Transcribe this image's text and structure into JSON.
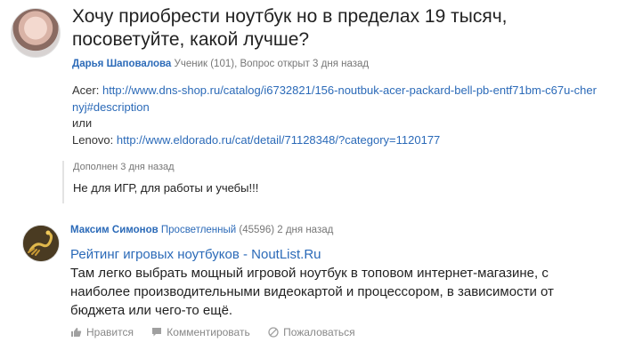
{
  "question": {
    "title": "Хочу приобрести ноутбук но в пределах 19 тысяч, посоветуйте, какой лучше?",
    "author": "Дарья Шаповалова",
    "author_meta": "Ученик (101), Вопрос открыт 3 дня назад",
    "body": {
      "acer_label": "Acer: ",
      "acer_link": "http://www.dns-shop.ru/catalog/i6732821/156-noutbuk-acer-packard-bell-pb-entf71bm-c67u-chernyj#description",
      "or_text": "или",
      "lenovo_label": "Lenovo: ",
      "lenovo_link": "http://www.eldorado.ru/cat/detail/71128348/?category=1120177"
    },
    "addition": {
      "meta": "Дополнен 3 дня назад",
      "text": "Не для ИГР, для работы и учебы!!!"
    }
  },
  "answer": {
    "author": "Максим Симонов",
    "rank": "Просветленный",
    "rank_meta": " (45596) 2 дня назад",
    "link_title": "Рейтинг игровых ноутбуков - NoutList.Ru",
    "text": "Там легко выбрать мощный игровой ноутбук в топовом интернет-магазине, с наиболее производительными видеокартой и процессором, в зависимости от бюджета или чего-то ещё.",
    "actions": {
      "like": "Нравится",
      "comment": "Комментировать",
      "report": "Пожаловаться"
    }
  },
  "colors": {
    "link": "#2b6ab8",
    "meta": "#777777",
    "action": "#888888"
  },
  "icons": [
    "thumbs-up-icon",
    "comment-icon",
    "report-icon"
  ]
}
